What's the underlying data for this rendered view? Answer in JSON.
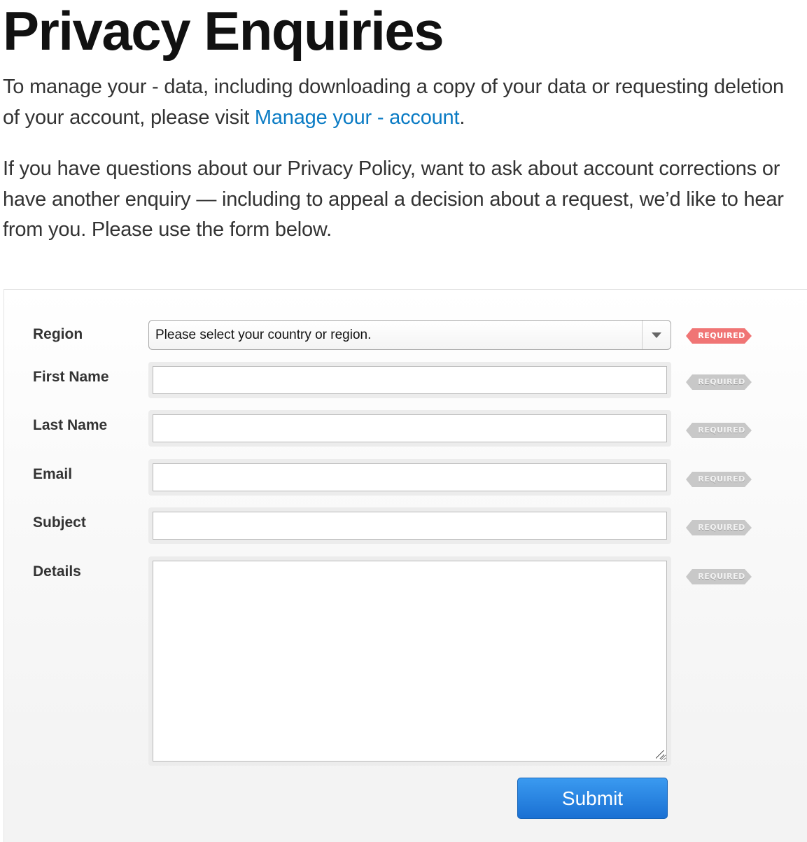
{
  "page": {
    "title": "Privacy Enquiries",
    "intro1_before": "To manage your - data, including downloading a copy of your data or requesting deletion of your account, please visit ",
    "intro1_link": "Manage your - account",
    "intro1_after": ".",
    "intro2": "If you have questions about our Privacy Policy, want to ask about account corrections or have another enquiry — including to appeal a decision about a request, we’d like to hear from you. Please use the form below."
  },
  "colors": {
    "link": "#0a7bc4",
    "required_active": "#f07575",
    "required_inactive": "#c8c8c8",
    "submit_button": "#1a70d3"
  },
  "form": {
    "region": {
      "label": "Region",
      "selected": "Please select your country or region.",
      "required": "REQUIRED",
      "icon": "chevron-down-icon"
    },
    "first_name": {
      "label": "First Name",
      "value": "",
      "required": "REQUIRED"
    },
    "last_name": {
      "label": "Last Name",
      "value": "",
      "required": "REQUIRED"
    },
    "email": {
      "label": "Email",
      "value": "",
      "required": "REQUIRED"
    },
    "subject": {
      "label": "Subject",
      "value": "",
      "required": "REQUIRED"
    },
    "details": {
      "label": "Details",
      "value": "",
      "required": "REQUIRED",
      "icon": "resize-grip-icon"
    },
    "submit_label": "Submit"
  }
}
